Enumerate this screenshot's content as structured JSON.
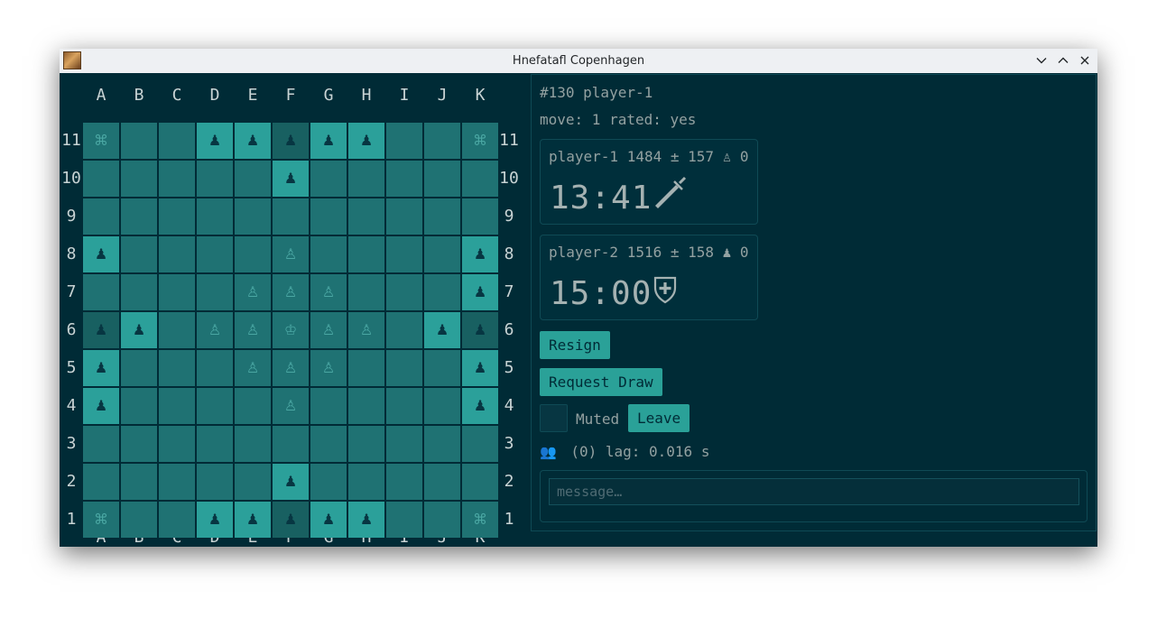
{
  "window": {
    "title": "Hnefatafl Copenhagen"
  },
  "board": {
    "files": [
      "A",
      "B",
      "C",
      "D",
      "E",
      "F",
      "G",
      "H",
      "I",
      "J",
      "K"
    ],
    "ranks": [
      "11",
      "10",
      "9",
      "8",
      "7",
      "6",
      "5",
      "4",
      "3",
      "2",
      "1"
    ],
    "rows": [
      "C..AAaAA..C",
      ".....A.....",
      "...........",
      "A....d....A",
      "....ddd...A",
      "aA.ddkdd.Aa",
      "A...ddd...A",
      "A....d....A",
      "...........",
      ".....A.....",
      "C..AAaAA..C"
    ],
    "legend": {
      "A": "attacker",
      "a": "attacker-on-dim-square",
      "d": "defender",
      "k": "king",
      "C": "corner",
      ".": "empty"
    },
    "glyphs": {
      "attacker": "♟",
      "defender": "♙",
      "king": "♔",
      "corner": "⌘"
    },
    "colors": {
      "square": "#1f7273",
      "lit_square": "#2ba09a",
      "dim_square": "#186061",
      "attacker": "#073642",
      "defender": "#4aa7a3"
    }
  },
  "game": {
    "header": "#130 player-1",
    "status": "move: 1 rated: yes"
  },
  "players": [
    {
      "head": "player-1 1484 ± 157 ♙ 0",
      "clock": "13:41",
      "role_icon": "dagger-icon"
    },
    {
      "head": "player-2 1516 ± 158 ♟ 0",
      "clock": "15:00",
      "role_icon": "shield-icon"
    }
  ],
  "actions": {
    "resign": "Resign",
    "request_draw": "Request Draw",
    "muted_label": "Muted",
    "leave": "Leave"
  },
  "status_line": {
    "users_icon": "👥",
    "text": "(0) lag: 0.016 s"
  },
  "chat": {
    "placeholder": "message…"
  },
  "theme": {
    "background": "#002b36",
    "accent": "#2aa198",
    "text": "#93a1a1"
  }
}
